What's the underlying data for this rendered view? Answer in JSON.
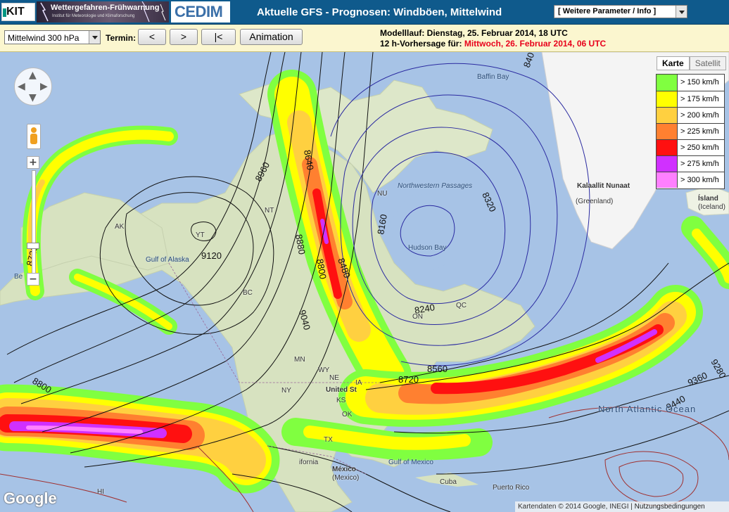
{
  "header": {
    "kit_logo": "KIT",
    "banner_title": "Wettergefahren-Frühwarnung",
    "banner_subtitle": "Institut für Meteorologie und Klimaforschung",
    "cedim_logo": "CEDIM",
    "title": "Aktuelle GFS - Prognosen: Windböen, Mittelwind",
    "more_select": "[ Weitere Parameter / Info ]"
  },
  "controls": {
    "level_select": "Mittelwind 300 hPa",
    "termin_label": "Termin:",
    "prev_label": "<",
    "next_label": ">",
    "first_label": "|<",
    "animation_label": "Animation",
    "run_label": "Modelllauf: Dienstag, 25. Februar 2014, 18 UTC",
    "forecast_prefix": "12 h-Vorhersage für:",
    "forecast_valid": "Mittwoch, 26. Februar 2014, 06 UTC"
  },
  "map": {
    "maptype": {
      "karte": "Karte",
      "satellit": "Satellit"
    },
    "legend": [
      {
        "label": "> 150 km/h",
        "color": "#80ff40"
      },
      {
        "label": "> 175 km/h",
        "color": "#ffff00"
      },
      {
        "label": "> 200 km/h",
        "color": "#ffd040"
      },
      {
        "label": "> 225 km/h",
        "color": "#ff8030"
      },
      {
        "label": "> 250 km/h",
        "color": "#ff1010"
      },
      {
        "label": "> 275 km/h",
        "color": "#d030ff"
      },
      {
        "label": "> 300 km/h",
        "color": "#ff80ff"
      }
    ],
    "contour_labels": [
      "8640",
      "8960",
      "8880",
      "8800",
      "8480",
      "9120",
      "9040",
      "8720",
      "8800",
      "8720",
      "8560",
      "8240",
      "8160",
      "8320",
      "840",
      "9280",
      "9360",
      "9440"
    ],
    "place_labels": {
      "baffin_bay": "Baffin Bay",
      "northwestern_passages": "Northwestern Passages",
      "hudson_bay": "Hudson Bay",
      "kalaallit": "Kalaallit Nunaat",
      "greenland": "(Greenland)",
      "island": "Ísland",
      "iceland": "(Iceland)",
      "gulf_of_alaska": "Gulf of Alaska",
      "bering": "Be",
      "united_states": "United St",
      "north_atlantic": "North Atlantic Ocean",
      "gulf_of_mexico": "Gulf of Mexico",
      "mexico": "México",
      "mexico_paren": "(Mexico)",
      "cuba": "Cuba",
      "puerto_rico": "Puerto Rico",
      "california": "ifornia",
      "yt": "YT",
      "nt": "NT",
      "nu": "NU",
      "bc": "BC",
      "ak": "AK",
      "on": "ON",
      "qc": "QC",
      "hi": "HI",
      "ne": "NE",
      "ks": "KS",
      "tx": "TX",
      "mn": "MN",
      "wy": "WY",
      "ny": "NY",
      "ia": "IA",
      "ok": "OK"
    },
    "google_logo": "Google",
    "attribution": "Kartendaten © 2014 Google, INEGI",
    "terms": "Nutzungsbedingungen"
  }
}
